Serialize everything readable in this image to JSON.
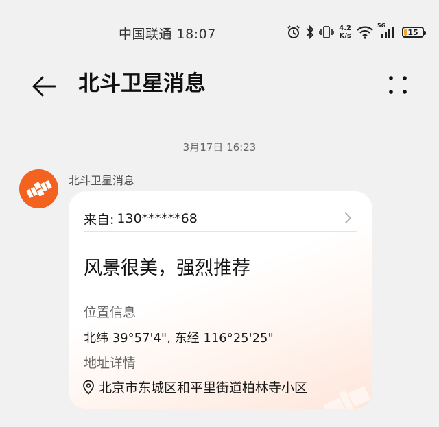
{
  "status_bar": {
    "carrier_time": "中国联通 18:07",
    "net_speed_value": "4.2",
    "net_speed_unit": "K/s",
    "network_type": "5G",
    "battery_level": "15",
    "icons": [
      "alarm-icon",
      "bluetooth-icon",
      "vibrate-icon",
      "wifi-icon",
      "signal-icon",
      "battery-icon"
    ]
  },
  "app_bar": {
    "title": "北斗卫星消息",
    "back_icon": "arrow-left-icon",
    "more_icon": "more-dots-icon"
  },
  "conversation": {
    "date_stamp": "3月17日 16:23",
    "sender": "北斗卫星消息",
    "avatar_icon": "satellite-icon",
    "avatar_color": "#f3621e",
    "card": {
      "from_label": "来自:",
      "from_number": "130******68",
      "message": "风景很美，强烈推荐",
      "location_label": "位置信息",
      "coordinates": "北纬 39°57'4\", 东经 116°25'25\"",
      "address_label": "地址详情",
      "address": "北京市东城区和平里街道柏林寺小区"
    }
  }
}
